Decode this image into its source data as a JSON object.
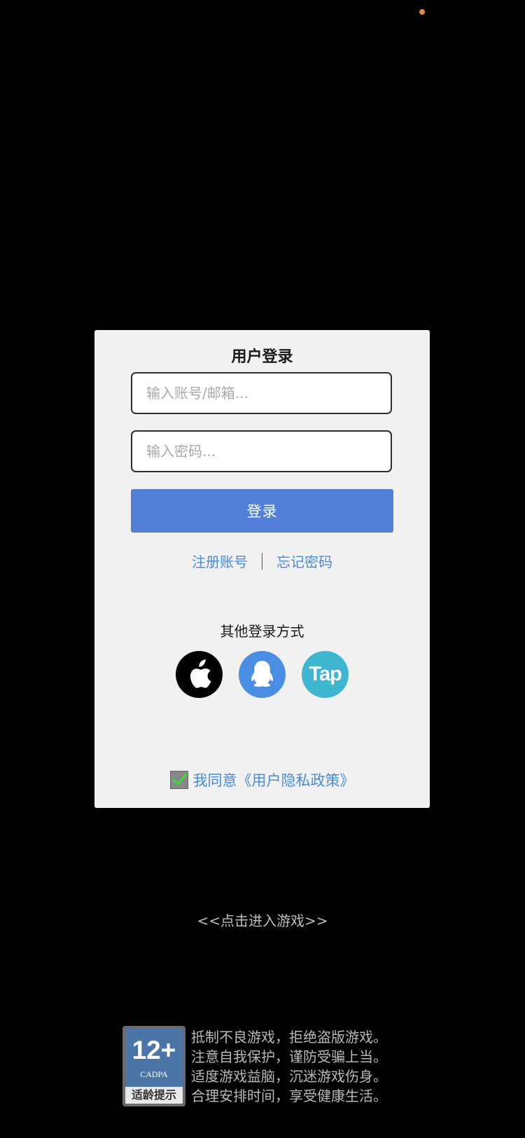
{
  "login_panel": {
    "title": "用户登录",
    "account_placeholder": "输入账号/邮箱...",
    "password_placeholder": "输入密码...",
    "login_button": "登录",
    "register_link": "注册账号",
    "forgot_link": "忘记密码",
    "other_login_title": "其他登录方式",
    "social_logins": [
      {
        "name": "apple",
        "icon": "apple-icon"
      },
      {
        "name": "qq",
        "icon": "qq-penguin-icon"
      },
      {
        "name": "taptap",
        "icon": "tap-icon",
        "label": "Tap"
      }
    ],
    "agreement_checked": true,
    "agreement_text": "我同意《用户隐私政策》"
  },
  "enter_game": "<<点击进入游戏>>",
  "age_rating": {
    "number": "12+",
    "org": "CADPA",
    "label": "适龄提示"
  },
  "health_notice": [
    "抵制不良游戏，拒绝盗版游戏。",
    "注意自我保护，谨防受骗上当。",
    "适度游戏益脑，沉迷游戏伤身。",
    "合理安排时间，享受健康生活。"
  ],
  "colors": {
    "background": "#000000",
    "panel": "#f1f1f2",
    "accent": "#5280d8",
    "link": "#4a8bd6",
    "qq": "#4a8ee3",
    "tap": "#3fb6cf"
  }
}
